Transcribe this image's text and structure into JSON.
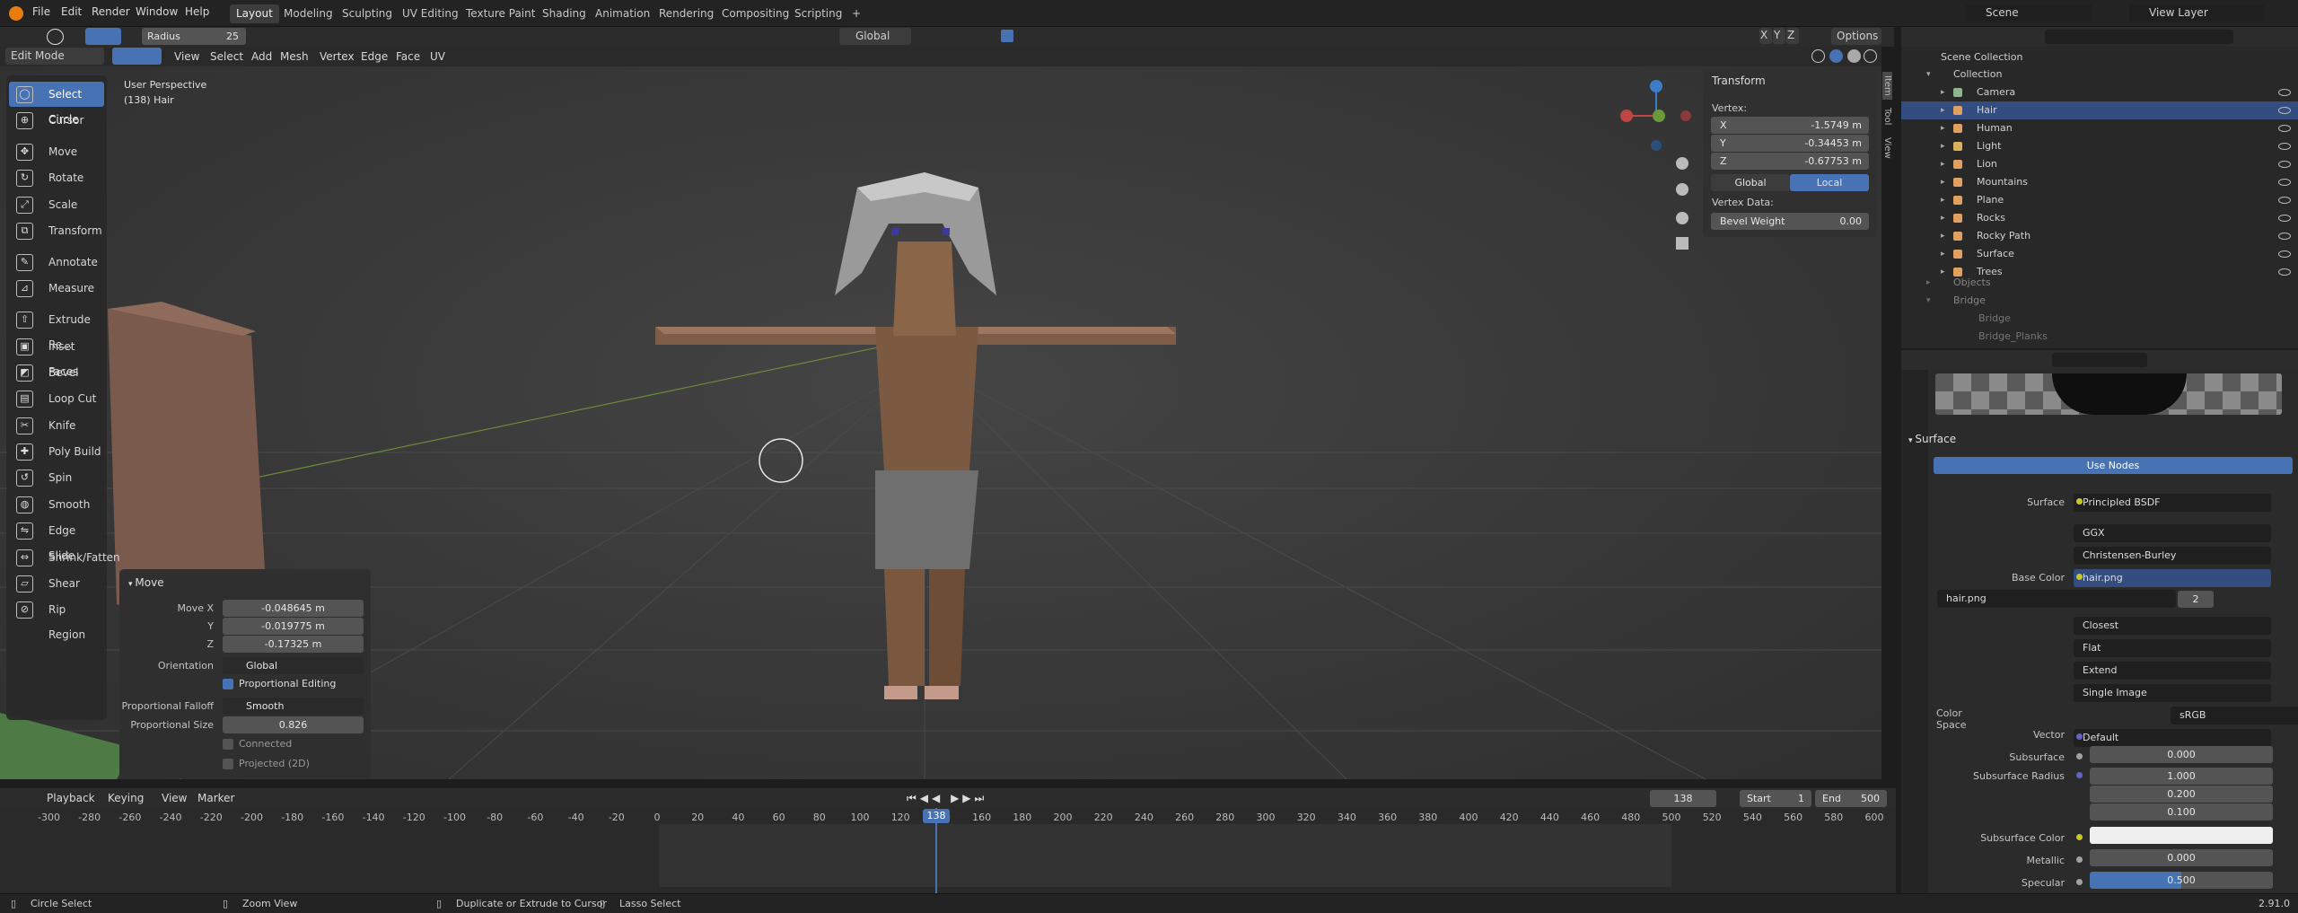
{
  "topbar": {
    "menus": [
      "File",
      "Edit",
      "Render",
      "Window",
      "Help"
    ],
    "workspaces": [
      "Layout",
      "Modeling",
      "Sculpting",
      "UV Editing",
      "Texture Paint",
      "Shading",
      "Animation",
      "Rendering",
      "Compositing",
      "Scripting",
      "+"
    ],
    "scene": "Scene",
    "view_layer": "View Layer"
  },
  "tool_header": {
    "radius_label": "Radius",
    "radius_value": "25",
    "orientation": "Global",
    "options": "Options",
    "axes": [
      "X",
      "Y",
      "Z"
    ]
  },
  "viewport_header": {
    "mode": "Edit Mode",
    "menus": [
      "View",
      "Select",
      "Add",
      "Mesh",
      "Vertex",
      "Edge",
      "Face",
      "UV"
    ]
  },
  "viewport": {
    "perspective": "User Perspective",
    "object": "(138) Hair"
  },
  "tools": [
    "Select Circle",
    "Cursor",
    "Move",
    "Rotate",
    "Scale",
    "Transform",
    "Annotate",
    "Measure",
    "Extrude Re...",
    "Inset Faces",
    "Bevel",
    "Loop Cut",
    "Knife",
    "Poly Build",
    "Spin",
    "Smooth",
    "Edge Slide",
    "Shrink/Fatten",
    "Shear",
    "Rip Region"
  ],
  "tool_icons": [
    "circle-select-icon",
    "cursor-icon",
    "move-icon",
    "rotate-icon",
    "scale-icon",
    "transform-icon",
    "annotate-icon",
    "measure-icon",
    "extrude-icon",
    "inset-icon",
    "bevel-icon",
    "loopcut-icon",
    "knife-icon",
    "polybuild-icon",
    "spin-icon",
    "smooth-icon",
    "edgeslide-icon",
    "shrink-icon",
    "shear-icon",
    "rip-icon"
  ],
  "npanel": {
    "title": "Transform",
    "vertex_label": "Vertex:",
    "x_label": "X",
    "x": "-1.5749 m",
    "y_label": "Y",
    "y": "-0.34453 m",
    "z_label": "Z",
    "z": "-0.67753 m",
    "global": "Global",
    "local": "Local",
    "vertex_data": "Vertex Data:",
    "bevel_label": "Bevel Weight",
    "bevel": "0.00",
    "tabs": [
      "Item",
      "Tool",
      "View"
    ]
  },
  "move_panel": {
    "title": "Move",
    "move_x_label": "Move X",
    "move_x": "-0.048645 m",
    "y_label": "Y",
    "y": "-0.019775 m",
    "z_label": "Z",
    "z": "-0.17325 m",
    "orientation_label": "Orientation",
    "orientation": "Global",
    "proportional": "Proportional Editing",
    "falloff_label": "Proportional Falloff",
    "falloff": "Smooth",
    "size_label": "Proportional Size",
    "size": "0.826",
    "connected": "Connected",
    "projected": "Projected (2D)"
  },
  "outliner": {
    "root": "Scene Collection",
    "collection": "Collection",
    "items": [
      "Camera",
      "Hair",
      "Human",
      "Light",
      "Lion",
      "Mountains",
      "Plane",
      "Rocks",
      "Rocky Path",
      "Surface",
      "Trees"
    ],
    "objects": "Objects",
    "bridge": "Bridge",
    "bridge_child": "Bridge",
    "bridge_planks": "Bridge_Planks"
  },
  "properties": {
    "section": "Surface",
    "use_nodes": "Use Nodes",
    "rows": [
      {
        "label": "Surface",
        "value": "Principled BSDF"
      },
      {
        "label": "",
        "value": "GGX"
      },
      {
        "label": "",
        "value": "Christensen-Burley"
      },
      {
        "label": "Base Color",
        "value": "hair.png"
      }
    ],
    "image_name": "hair.png",
    "image_users": "2",
    "image_opts": [
      "Closest",
      "Flat",
      "Extend",
      "Single Image"
    ],
    "color_space_label": "Color Space",
    "color_space": "sRGB",
    "vector_label": "Vector",
    "vector": "Default",
    "subsurface_label": "Subsurface",
    "subsurface": "0.000",
    "radius_label": "Subsurface Radius",
    "radius": [
      "1.000",
      "0.200",
      "0.100"
    ],
    "sscolor_label": "Subsurface Color",
    "metallic_label": "Metallic",
    "metallic": "0.000",
    "specular_label": "Specular",
    "specular": "0.500",
    "specular_fraction": 0.5
  },
  "timeline": {
    "menus": [
      "Playback",
      "Keying",
      "View",
      "Marker"
    ],
    "current_frame": "138",
    "start_label": "Start",
    "start": "1",
    "end_label": "End",
    "end": "500",
    "ticks": [
      "-300",
      "-280",
      "-260",
      "-240",
      "-220",
      "-200",
      "-180",
      "-160",
      "-140",
      "-120",
      "-100",
      "-80",
      "-60",
      "-40",
      "-20",
      "0",
      "20",
      "40",
      "60",
      "80",
      "100",
      "120",
      "140",
      "160",
      "180",
      "200",
      "220",
      "240",
      "260",
      "280",
      "300",
      "320",
      "340",
      "360",
      "380",
      "400",
      "420",
      "440",
      "460",
      "480",
      "500",
      "520",
      "540",
      "560",
      "580",
      "600"
    ]
  },
  "statusbar": {
    "items": [
      "Circle Select",
      "Zoom View",
      "Duplicate or Extrude to Cursor",
      "Lasso Select"
    ],
    "version": "2.91.0"
  }
}
